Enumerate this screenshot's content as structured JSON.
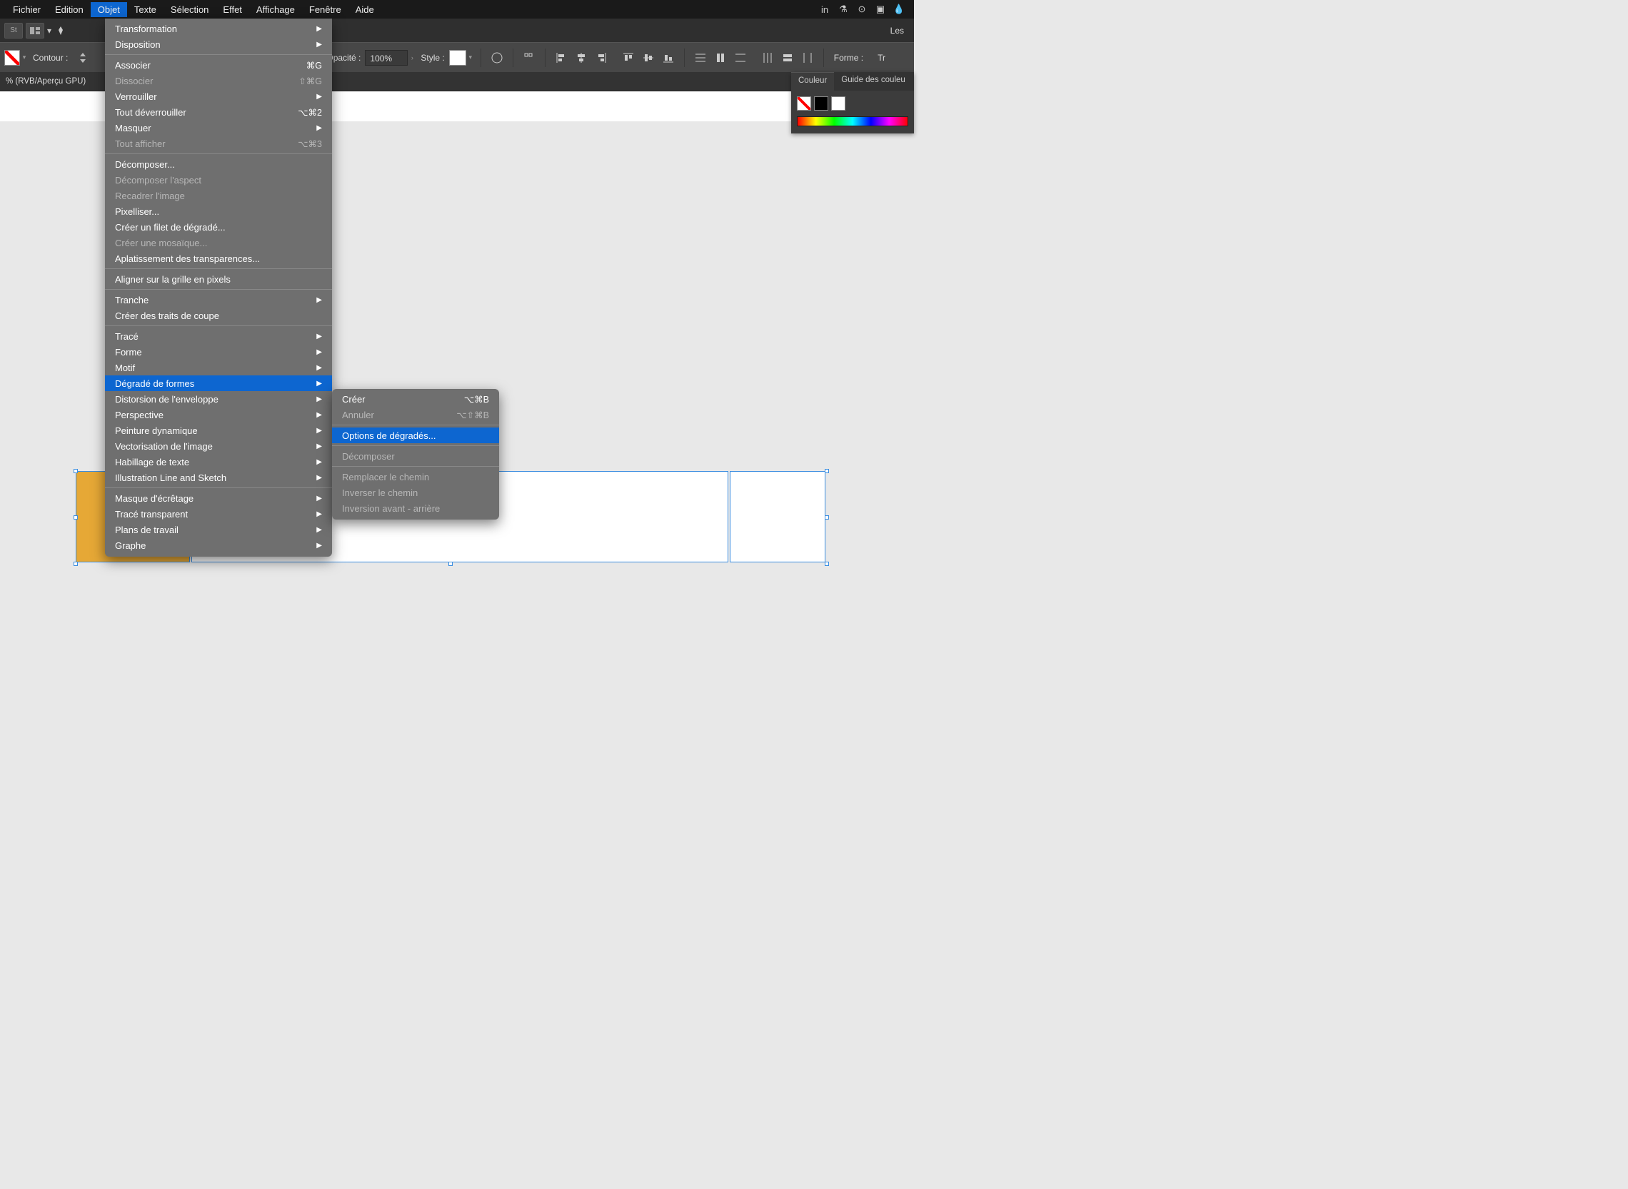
{
  "menubar": {
    "items": [
      "Fichier",
      "Edition",
      "Objet",
      "Texte",
      "Sélection",
      "Effet",
      "Affichage",
      "Fenêtre",
      "Aide"
    ],
    "active_index": 2
  },
  "appbar": {
    "st_label": "St",
    "search_label": "Les "
  },
  "controlbar": {
    "contour_label": "Contour :",
    "opacity_label": "Opacité :",
    "opacity_value": "100%",
    "style_label": "Style :",
    "forme_label": "Forme :",
    "tr_label": "Tr"
  },
  "doctab": {
    "title": "% (RVB/Aperçu GPU)"
  },
  "dropdown": {
    "groups": [
      [
        {
          "label": "Transformation",
          "arrow": true
        },
        {
          "label": "Disposition",
          "arrow": true
        }
      ],
      [
        {
          "label": "Associer",
          "shortcut": "⌘G"
        },
        {
          "label": "Dissocier",
          "shortcut": "⇧⌘G",
          "disabled": true
        },
        {
          "label": "Verrouiller",
          "arrow": true
        },
        {
          "label": "Tout déverrouiller",
          "shortcut": "⌥⌘2"
        },
        {
          "label": "Masquer",
          "arrow": true
        },
        {
          "label": "Tout afficher",
          "shortcut": "⌥⌘3",
          "disabled": true
        }
      ],
      [
        {
          "label": "Décomposer..."
        },
        {
          "label": "Décomposer l'aspect",
          "disabled": true
        },
        {
          "label": "Recadrer l'image",
          "disabled": true
        },
        {
          "label": "Pixelliser..."
        },
        {
          "label": "Créer un filet de dégradé..."
        },
        {
          "label": "Créer une mosaïque...",
          "disabled": true
        },
        {
          "label": "Aplatissement des transparences..."
        }
      ],
      [
        {
          "label": "Aligner sur la grille en pixels"
        }
      ],
      [
        {
          "label": "Tranche",
          "arrow": true
        },
        {
          "label": "Créer des traits de coupe"
        }
      ],
      [
        {
          "label": "Tracé",
          "arrow": true
        },
        {
          "label": "Forme",
          "arrow": true
        },
        {
          "label": "Motif",
          "arrow": true
        },
        {
          "label": "Dégradé de formes",
          "arrow": true,
          "highlight": true
        },
        {
          "label": "Distorsion de l'enveloppe",
          "arrow": true
        },
        {
          "label": "Perspective",
          "arrow": true
        },
        {
          "label": "Peinture dynamique",
          "arrow": true
        },
        {
          "label": "Vectorisation de l'image",
          "arrow": true
        },
        {
          "label": "Habillage de texte",
          "arrow": true
        },
        {
          "label": "Illustration Line and Sketch",
          "arrow": true
        }
      ],
      [
        {
          "label": "Masque d'écrêtage",
          "arrow": true
        },
        {
          "label": "Tracé transparent",
          "arrow": true
        },
        {
          "label": "Plans de travail",
          "arrow": true
        },
        {
          "label": "Graphe",
          "arrow": true
        }
      ]
    ]
  },
  "submenu": {
    "groups": [
      [
        {
          "label": "Créer",
          "shortcut": "⌥⌘B"
        },
        {
          "label": "Annuler",
          "shortcut": "⌥⇧⌘B",
          "disabled": true
        }
      ],
      [
        {
          "label": "Options de dégradés...",
          "highlight": true
        }
      ],
      [
        {
          "label": "Décomposer",
          "disabled": true
        }
      ],
      [
        {
          "label": "Remplacer le chemin",
          "disabled": true
        },
        {
          "label": "Inverser le chemin",
          "disabled": true
        },
        {
          "label": "Inversion avant - arrière",
          "disabled": true
        }
      ]
    ]
  },
  "sidepanel": {
    "tab1": "Couleur",
    "tab2": "Guide des couleu"
  }
}
